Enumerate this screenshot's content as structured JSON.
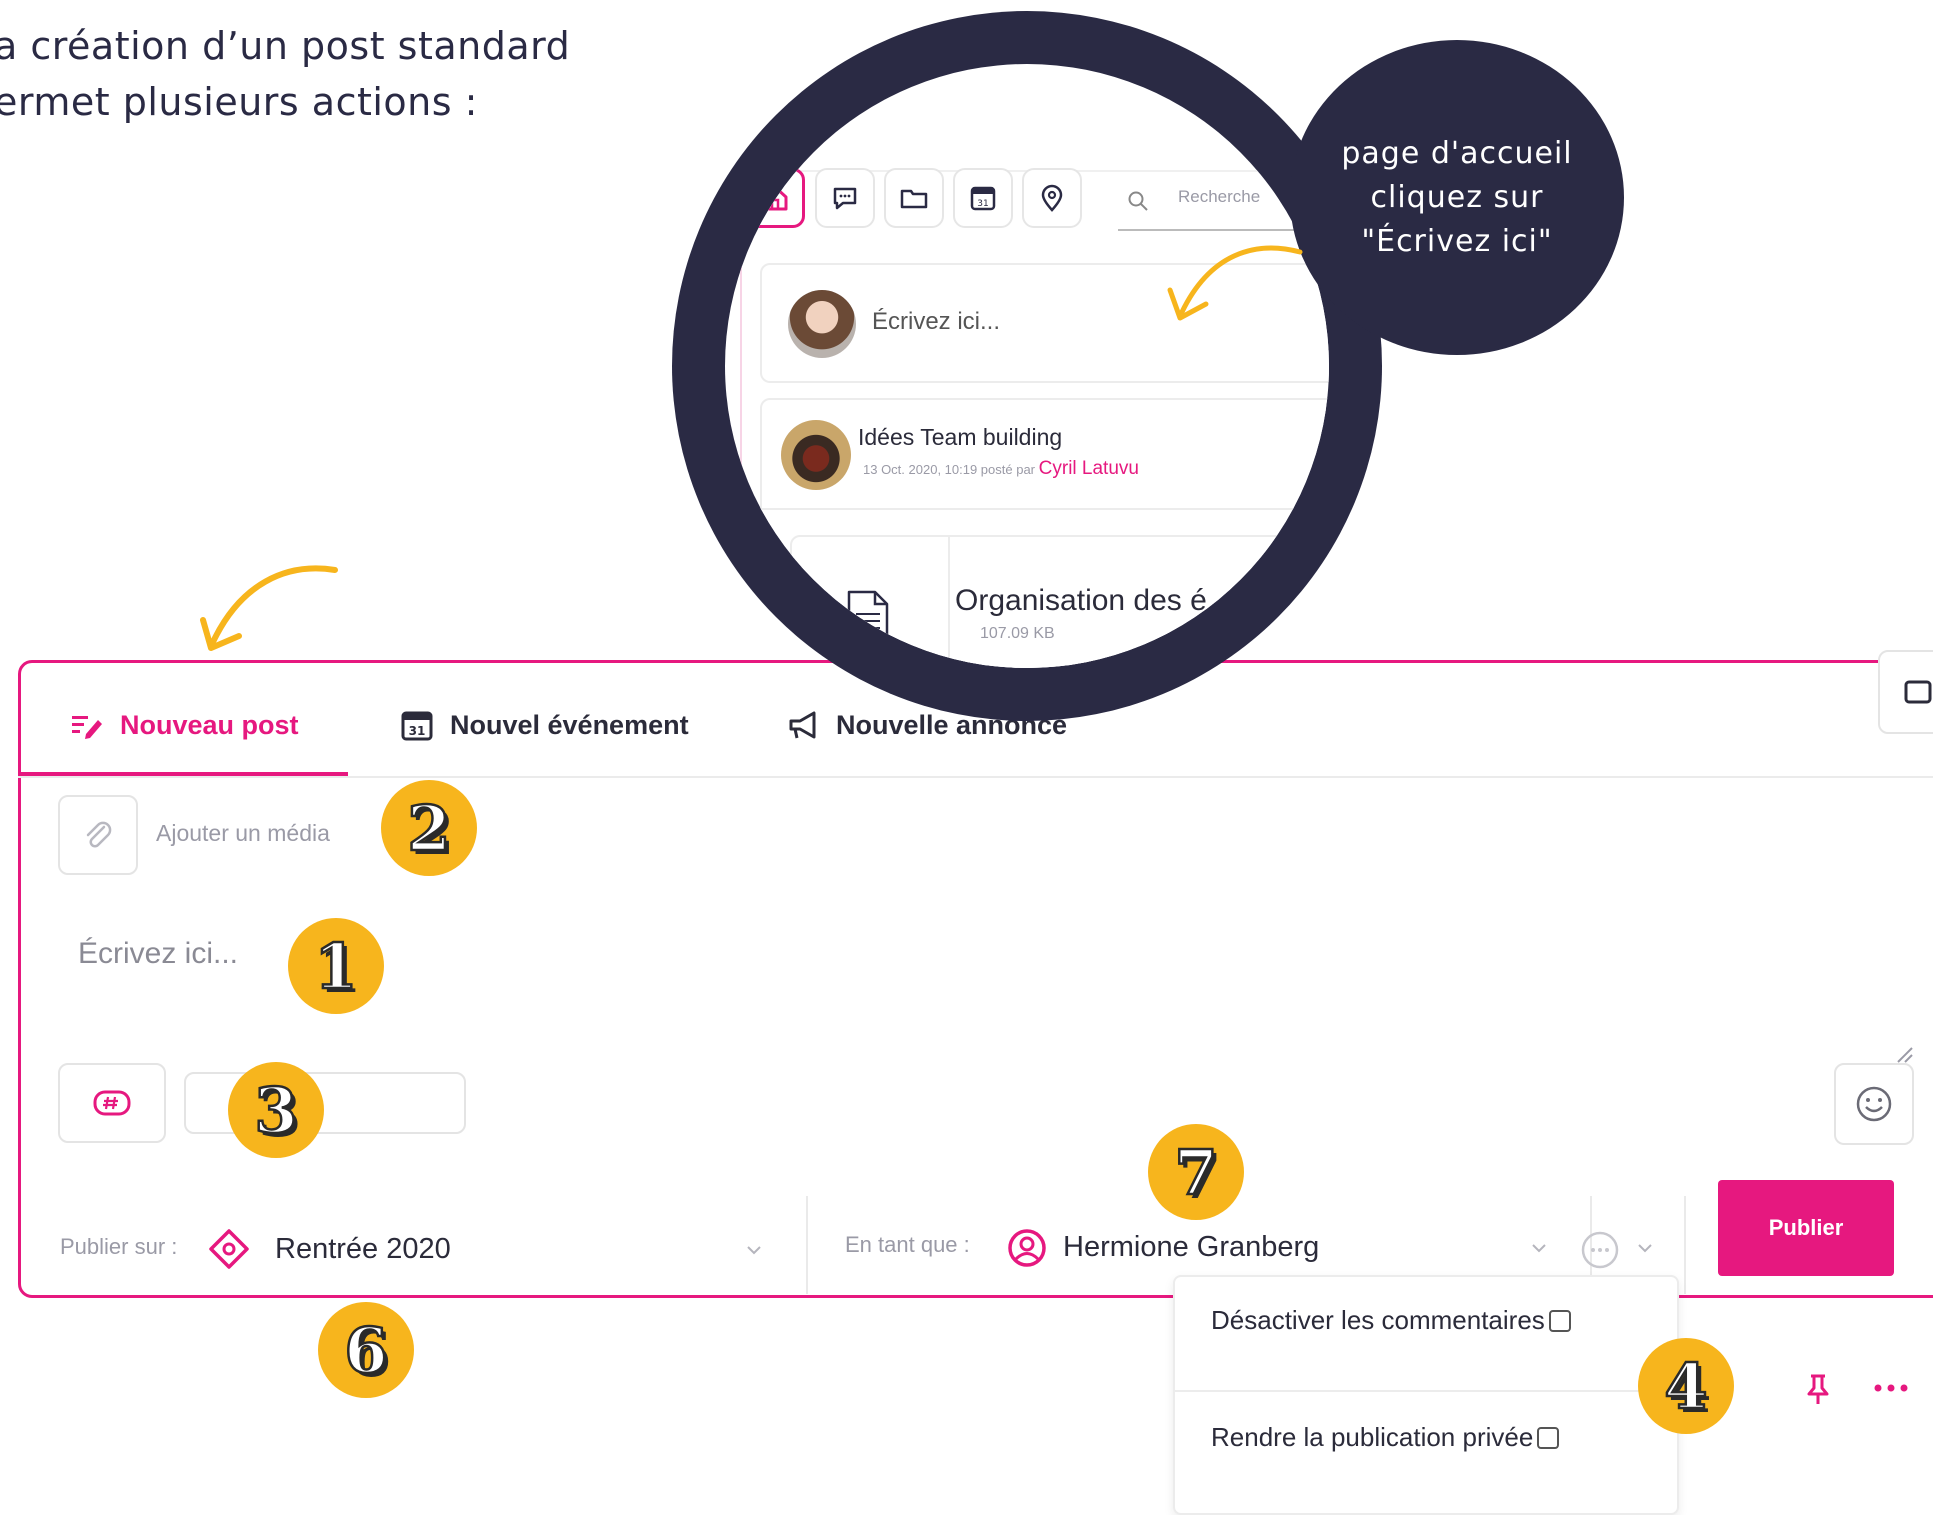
{
  "intro": {
    "line1": "a création d’un post standard",
    "line2": "ermet plusieurs actions :"
  },
  "composer": {
    "tabs": [
      {
        "label": "Nouveau post",
        "icon": "edit-post-icon",
        "active": true
      },
      {
        "label": "Nouvel événement",
        "icon": "calendar-icon",
        "day": "31"
      },
      {
        "label": "Nouvelle annonce",
        "icon": "megaphone-icon"
      }
    ],
    "add_media_label": "Ajouter un média",
    "textarea_placeholder": "Écrivez ici...",
    "hashtag_icon": "hashtag-icon",
    "emoji_icon": "emoji-icon",
    "publish_on": {
      "label": "Publier sur :",
      "value": "Rentrée 2020"
    },
    "as_user": {
      "label": "En tant que :",
      "value": "Hermione Granberg"
    },
    "publish_button": "Publier",
    "options_menu": [
      {
        "label": "Désactiver les commentaires",
        "checked": false
      },
      {
        "label": "Rendre la publication privée",
        "checked": false
      }
    ]
  },
  "magnifier": {
    "search_placeholder": "Recherche",
    "calendar_day": "31",
    "write_placeholder": "Écrivez ici...",
    "post": {
      "title": "Idées Team building",
      "meta": "13 Oct. 2020, 10:19 posté par",
      "author": "Cyril Latuvu",
      "attachment_name": "Organisation des é",
      "attachment_size": "107.09 KB"
    }
  },
  "callout": {
    "line1": "page d'accueil",
    "line2": "cliquez sur",
    "line3": "\"Écrivez ici\""
  },
  "badges": [
    "1",
    "2",
    "3",
    "4",
    "6",
    "7"
  ],
  "colors": {
    "accent": "#e6187f",
    "dark_navy": "#2a2a44",
    "badge_yellow": "#f7b51d"
  }
}
